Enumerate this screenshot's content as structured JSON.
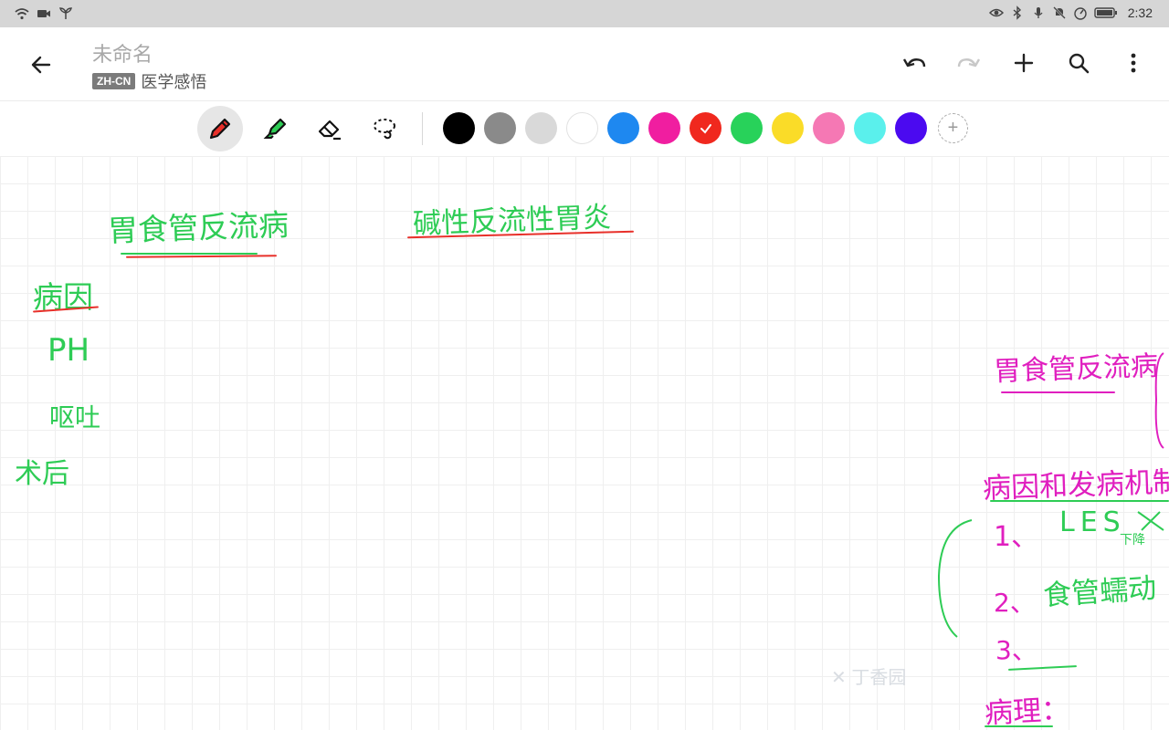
{
  "status_bar": {
    "time": "2:32",
    "left_icons": [
      "wifi-icon",
      "video-icon",
      "app-leaf-icon"
    ],
    "right_icons": [
      "eye-icon",
      "bluetooth-icon",
      "mic-icon",
      "bell-off-icon",
      "gauge-icon",
      "battery-icon"
    ]
  },
  "app_bar": {
    "title": "未命名",
    "lang_badge": "ZH-CN",
    "notebook": "医学感悟"
  },
  "toolbar": {
    "tools": [
      "pen",
      "highlighter",
      "eraser",
      "lasso"
    ],
    "active_tool": "pen",
    "colors": [
      "#000000",
      "#8a8a8a",
      "#d9d9d9",
      "#ffffff",
      "#1e88f0",
      "#f01ea0",
      "#f0281e",
      "#28d25a",
      "#fadc28",
      "#f578b4",
      "#5af0ec",
      "#4b0af0"
    ],
    "selected_color": "#f0281e"
  },
  "canvas": {
    "notes": {
      "gerd_title": "胃食管反流病",
      "alkaline_title": "碱性反流性胃炎",
      "etiology": "病因",
      "ph": "PH",
      "vomit": "呕吐",
      "surgery": "术后",
      "right_title": "胃食管反流病",
      "pathogenesis": "病因和发病机制",
      "item1_num": "1、",
      "item1_text": "LES",
      "item1_sub": "下降",
      "item2_num": "2、",
      "item2_text": "食管蠕动",
      "item3_num": "3、",
      "pathology": "病理："
    },
    "watermark": "丁香园"
  }
}
